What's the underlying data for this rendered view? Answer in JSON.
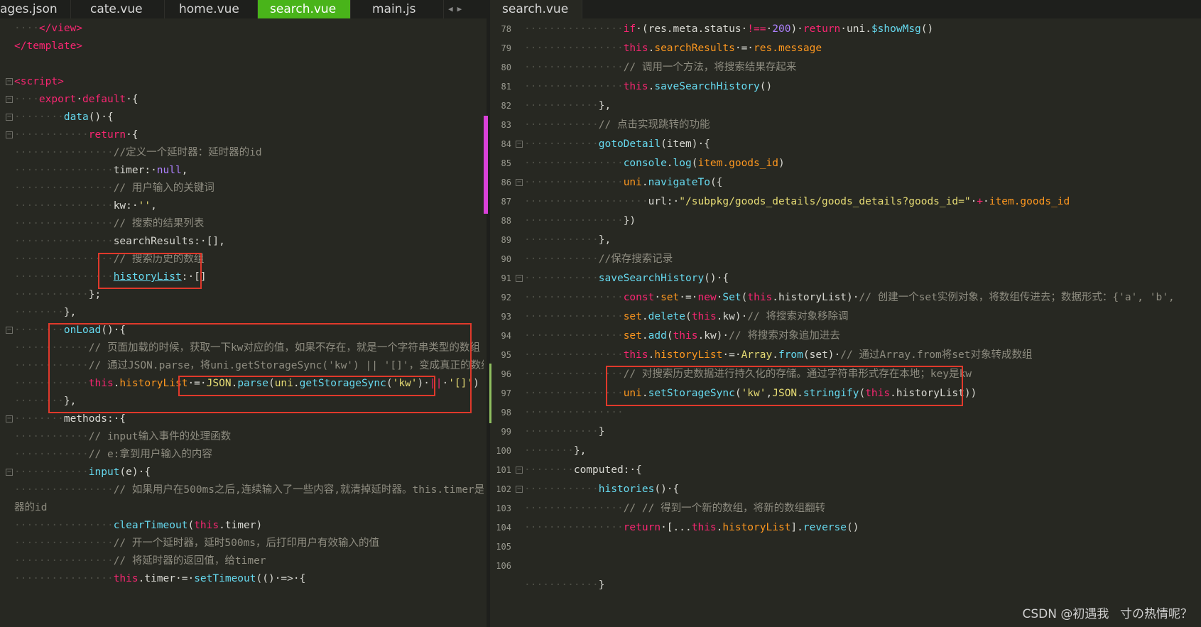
{
  "left_tabs": [
    {
      "label": "ages.json",
      "active": false
    },
    {
      "label": "cate.vue",
      "active": false
    },
    {
      "label": "home.vue",
      "active": false
    },
    {
      "label": "search.vue",
      "active": true
    },
    {
      "label": "main.js",
      "active": false
    }
  ],
  "right_tabs": [
    {
      "label": "search.vue",
      "active": true
    }
  ],
  "tab_nav": {
    "prev": "◀",
    "next": "▶"
  },
  "accent_color": "#49b41a",
  "left_lines": [
    {
      "indent": "····",
      "segs": [
        [
          "tag",
          "</view>"
        ]
      ]
    },
    {
      "indent": "",
      "segs": [
        [
          "tag",
          "</template>"
        ]
      ]
    },
    {
      "indent": "",
      "segs": []
    },
    {
      "indent": "",
      "fold": true,
      "segs": [
        [
          "tag",
          "<script>"
        ]
      ]
    },
    {
      "indent": "····",
      "fold": true,
      "segs": [
        [
          "kw",
          "export"
        ],
        [
          "pl",
          " "
        ],
        [
          "kw",
          "default"
        ],
        [
          "pl",
          " {"
        ]
      ]
    },
    {
      "indent": "········",
      "fold": true,
      "segs": [
        [
          "fn",
          "data"
        ],
        [
          "pl",
          "() {"
        ]
      ]
    },
    {
      "indent": "············",
      "fold": true,
      "segs": [
        [
          "kw",
          "return"
        ],
        [
          "pl",
          " {"
        ]
      ]
    },
    {
      "indent": "················",
      "segs": [
        [
          "cm",
          "//定义一个延时器：延时器的id"
        ]
      ]
    },
    {
      "indent": "················",
      "segs": [
        [
          "pl",
          "timer: "
        ],
        [
          "num",
          "null"
        ],
        [
          "pl",
          ","
        ]
      ]
    },
    {
      "indent": "················",
      "segs": [
        [
          "cm",
          "// 用户输入的关键词"
        ]
      ]
    },
    {
      "indent": "················",
      "segs": [
        [
          "pl",
          "kw: "
        ],
        [
          "str",
          "''"
        ],
        [
          "pl",
          ","
        ]
      ]
    },
    {
      "indent": "················",
      "segs": [
        [
          "cm",
          "// 搜索的结果列表"
        ]
      ]
    },
    {
      "indent": "················",
      "segs": [
        [
          "pl",
          "searchResults: [],"
        ]
      ]
    },
    {
      "indent": "················",
      "segs": [
        [
          "cm",
          "// 搜索历史的数组"
        ]
      ]
    },
    {
      "indent": "················",
      "segs": [
        [
          "ul",
          "historyList"
        ],
        [
          "pl",
          ": []"
        ]
      ]
    },
    {
      "indent": "············",
      "segs": [
        [
          "pl",
          "};"
        ]
      ]
    },
    {
      "indent": "········",
      "segs": [
        [
          "pl",
          "},"
        ]
      ]
    },
    {
      "indent": "········",
      "fold": true,
      "segs": [
        [
          "fn",
          "onLoad"
        ],
        [
          "pl",
          "() {"
        ]
      ]
    },
    {
      "indent": "············",
      "segs": [
        [
          "cm",
          "// 页面加载的时候，获取一下kw对应的值，如果不存在，就是一个字符串类型的数组"
        ]
      ]
    },
    {
      "indent": "············",
      "segs": [
        [
          "cm",
          "// 通过JSON.parse，将uni.getStorageSync('kw') || '[]'，变成真正的数组"
        ]
      ]
    },
    {
      "indent": "············",
      "segs": [
        [
          "kw",
          "this"
        ],
        [
          "pl",
          "."
        ],
        [
          "id",
          "historyList"
        ],
        [
          "pl",
          " = "
        ],
        [
          "str",
          "JSON"
        ],
        [
          "pl",
          "."
        ],
        [
          "fn",
          "parse"
        ],
        [
          "pl",
          "("
        ],
        [
          "str",
          "uni"
        ],
        [
          "pl",
          "."
        ],
        [
          "fn",
          "getStorageSync"
        ],
        [
          "pl",
          "("
        ],
        [
          "str",
          "'kw'"
        ],
        [
          "pl",
          ") "
        ],
        [
          "kw",
          "||"
        ],
        [
          "pl",
          " "
        ],
        [
          "str",
          "'[]'"
        ],
        [
          "pl",
          ")"
        ]
      ]
    },
    {
      "indent": "········",
      "segs": [
        [
          "pl",
          "},"
        ]
      ]
    },
    {
      "indent": "········",
      "fold": true,
      "segs": [
        [
          "pl",
          "methods: {"
        ]
      ]
    },
    {
      "indent": "············",
      "segs": [
        [
          "cm",
          "// input输入事件的处理函数"
        ]
      ]
    },
    {
      "indent": "············",
      "segs": [
        [
          "cm",
          "// e:拿到用户输入的内容"
        ]
      ]
    },
    {
      "indent": "············",
      "fold": true,
      "segs": [
        [
          "fn",
          "input"
        ],
        [
          "pl",
          "(e) {"
        ]
      ]
    },
    {
      "indent": "················",
      "segs": [
        [
          "cm",
          "// 如果用户在500ms之后,连续输入了一些内容,就清掉延时器。this.timer是延时"
        ]
      ]
    },
    {
      "indent": "",
      "segs": [
        [
          "cm",
          "器的id"
        ]
      ]
    },
    {
      "indent": "················",
      "segs": [
        [
          "fn",
          "clearTimeout"
        ],
        [
          "pl",
          "("
        ],
        [
          "kw",
          "this"
        ],
        [
          "pl",
          ".timer)"
        ]
      ]
    },
    {
      "indent": "················",
      "segs": [
        [
          "cm",
          "// 开一个延时器，延时500ms，后打印用户有效输入的值"
        ]
      ]
    },
    {
      "indent": "················",
      "segs": [
        [
          "cm",
          "// 将延时器的返回值，给timer"
        ]
      ]
    },
    {
      "indent": "················",
      "segs": [
        [
          "kw",
          "this"
        ],
        [
          "pl",
          ".timer = "
        ],
        [
          "fn",
          "setTimeout"
        ],
        [
          "pl",
          "(() => {"
        ]
      ]
    }
  ],
  "right_lines": [
    {
      "n": "78",
      "indent": "················",
      "segs": [
        [
          "kw",
          "if"
        ],
        [
          "pl",
          " (res.meta.status "
        ],
        [
          "kw",
          "!=="
        ],
        [
          "pl",
          " "
        ],
        [
          "num",
          "200"
        ],
        [
          "pl",
          ") "
        ],
        [
          "kw",
          "return"
        ],
        [
          "pl",
          " uni."
        ],
        [
          "fn",
          "$showMsg"
        ],
        [
          "pl",
          "()"
        ]
      ]
    },
    {
      "n": "79",
      "indent": "················",
      "segs": [
        [
          "kw",
          "this"
        ],
        [
          "pl",
          "."
        ],
        [
          "id",
          "searchResults"
        ],
        [
          "pl",
          " = "
        ],
        [
          "id",
          "res.message"
        ]
      ]
    },
    {
      "n": "80",
      "indent": "················",
      "segs": [
        [
          "cm",
          "// 调用一个方法，将搜索结果存起来"
        ]
      ]
    },
    {
      "n": "81",
      "indent": "················",
      "segs": [
        [
          "kw",
          "this"
        ],
        [
          "pl",
          "."
        ],
        [
          "fn",
          "saveSearchHistory"
        ],
        [
          "pl",
          "()"
        ]
      ]
    },
    {
      "n": "82",
      "indent": "············",
      "segs": [
        [
          "pl",
          "},"
        ]
      ]
    },
    {
      "n": "83",
      "indent": "············",
      "segs": [
        [
          "cm",
          "// 点击实现跳转的功能"
        ]
      ]
    },
    {
      "n": "84",
      "indent": "············",
      "fold": true,
      "segs": [
        [
          "fn",
          "gotoDetail"
        ],
        [
          "pl",
          "(item) {"
        ]
      ]
    },
    {
      "n": "85",
      "indent": "················",
      "segs": [
        [
          "fn",
          "console"
        ],
        [
          "pl",
          "."
        ],
        [
          "fn",
          "log"
        ],
        [
          "pl",
          "("
        ],
        [
          "id",
          "item.goods_id"
        ],
        [
          "pl",
          ")"
        ]
      ]
    },
    {
      "n": "86",
      "indent": "················",
      "fold": true,
      "segs": [
        [
          "id",
          "uni"
        ],
        [
          "pl",
          "."
        ],
        [
          "fn",
          "navigateTo"
        ],
        [
          "pl",
          "({"
        ]
      ]
    },
    {
      "n": "87",
      "indent": "····················",
      "segs": [
        [
          "pl",
          "url: "
        ],
        [
          "str",
          "\"/subpkg/goods_details/goods_details?goods_id=\""
        ],
        [
          "pl",
          " "
        ],
        [
          "kw",
          "+"
        ],
        [
          "pl",
          " "
        ],
        [
          "id",
          "item.goods_id"
        ]
      ]
    },
    {
      "n": "88",
      "indent": "················",
      "segs": [
        [
          "pl",
          "})"
        ]
      ]
    },
    {
      "n": "89",
      "indent": "············",
      "segs": [
        [
          "pl",
          "},"
        ]
      ]
    },
    {
      "n": "90",
      "indent": "············",
      "segs": [
        [
          "cm",
          "//保存搜索记录"
        ]
      ]
    },
    {
      "n": "91",
      "indent": "············",
      "fold": true,
      "segs": [
        [
          "fn",
          "saveSearchHistory"
        ],
        [
          "pl",
          "() {"
        ]
      ]
    },
    {
      "n": "92",
      "indent": "················",
      "segs": [
        [
          "kw",
          "const"
        ],
        [
          "pl",
          " "
        ],
        [
          "id",
          "set"
        ],
        [
          "pl",
          " = "
        ],
        [
          "kw",
          "new"
        ],
        [
          "pl",
          " "
        ],
        [
          "fn",
          "Set"
        ],
        [
          "pl",
          "("
        ],
        [
          "kw",
          "this"
        ],
        [
          "pl",
          ".historyList) "
        ],
        [
          "cm",
          "// 创建一个set实例对象，将数组传进去；数据形式：{'a', 'b',"
        ]
      ]
    },
    {
      "n": "93",
      "indent": "················",
      "segs": [
        [
          "id",
          "set"
        ],
        [
          "pl",
          "."
        ],
        [
          "fn",
          "delete"
        ],
        [
          "pl",
          "("
        ],
        [
          "kw",
          "this"
        ],
        [
          "pl",
          ".kw) "
        ],
        [
          "cm",
          "// 将搜索对象移除调"
        ]
      ]
    },
    {
      "n": "94",
      "indent": "················",
      "segs": [
        [
          "id",
          "set"
        ],
        [
          "pl",
          "."
        ],
        [
          "fn",
          "add"
        ],
        [
          "pl",
          "("
        ],
        [
          "kw",
          "this"
        ],
        [
          "pl",
          ".kw) "
        ],
        [
          "cm",
          "// 将搜索对象追加进去"
        ]
      ]
    },
    {
      "n": "95",
      "indent": "················",
      "segs": [
        [
          "kw",
          "this"
        ],
        [
          "pl",
          "."
        ],
        [
          "id",
          "historyList"
        ],
        [
          "pl",
          " = "
        ],
        [
          "str",
          "Array"
        ],
        [
          "pl",
          "."
        ],
        [
          "fn",
          "from"
        ],
        [
          "pl",
          "(set) "
        ],
        [
          "cm",
          "// 通过Array.from将set对象转成数组"
        ]
      ]
    },
    {
      "n": "96",
      "indent": "················",
      "segs": [
        [
          "cm",
          "// 对搜索历史数据进行持久化的存储。通过字符串形式存在本地；key是kw"
        ]
      ]
    },
    {
      "n": "97",
      "indent": "················",
      "segs": [
        [
          "id",
          "uni"
        ],
        [
          "pl",
          "."
        ],
        [
          "fn",
          "setStorageSync"
        ],
        [
          "pl",
          "("
        ],
        [
          "str",
          "'kw'"
        ],
        [
          "pl",
          ","
        ],
        [
          "str",
          "JSON"
        ],
        [
          "pl",
          "."
        ],
        [
          "fn",
          "stringify"
        ],
        [
          "pl",
          "("
        ],
        [
          "kw",
          "this"
        ],
        [
          "pl",
          ".historyList))"
        ]
      ]
    },
    {
      "n": "98",
      "indent": "················",
      "segs": []
    },
    {
      "n": "99",
      "indent": "············",
      "segs": [
        [
          "pl",
          "}"
        ]
      ]
    },
    {
      "n": "100",
      "indent": "········",
      "segs": [
        [
          "pl",
          "},"
        ]
      ]
    },
    {
      "n": "101",
      "indent": "········",
      "fold": true,
      "segs": [
        [
          "pl",
          "computed: {"
        ]
      ]
    },
    {
      "n": "102",
      "indent": "············",
      "fold": true,
      "segs": [
        [
          "fn",
          "histories"
        ],
        [
          "pl",
          "() {"
        ]
      ]
    },
    {
      "n": "103",
      "indent": "················",
      "segs": [
        [
          "cm",
          "// // 得到一个新的数组，将新的数组翻转"
        ]
      ]
    },
    {
      "n": "104",
      "indent": "················",
      "segs": [
        [
          "kw",
          "return"
        ],
        [
          "pl",
          " [..."
        ],
        [
          "kw",
          "this"
        ],
        [
          "pl",
          "."
        ],
        [
          "id",
          "historyList"
        ],
        [
          "pl",
          "]."
        ],
        [
          "fn",
          "reverse"
        ],
        [
          "pl",
          "()"
        ]
      ]
    },
    {
      "n": "105",
      "indent": "",
      "segs": []
    },
    {
      "n": "106",
      "indent": "",
      "segs": []
    },
    {
      "n": "",
      "indent": "············",
      "segs": [
        [
          "pl",
          "}"
        ]
      ]
    }
  ],
  "watermark": "CSDN @初遇我ㅤ寸の热情呢？"
}
